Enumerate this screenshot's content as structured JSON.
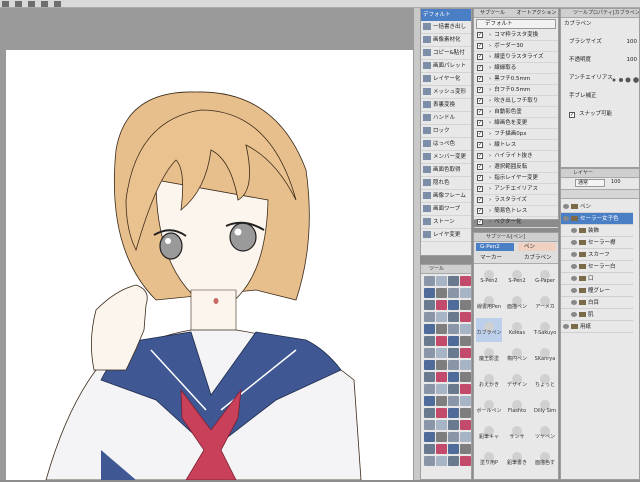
{
  "toolbar": {
    "buttons": [
      "icon-a",
      "icon-b",
      "icon-c",
      "icon-d",
      "icon-e"
    ]
  },
  "auto_action": {
    "tab1": "サブツール",
    "tab2": "オートアクション",
    "set": "デフォルト",
    "items": [
      "コマ枠ラスタ変換",
      "ボーダー30",
      "線塗りラスタライズ",
      "線縁取る",
      "黒フチ0.5mm",
      "白フチ0.5mm",
      "吹き出しフチ取り",
      "自動影色塗",
      "線画色を変更",
      "フチ描画0px",
      "線トレス",
      "ハイライト抜き",
      "選択範囲反転",
      "指示レイヤー変更",
      "アンチエイリアス",
      "ラスタライズ",
      "簡易色トレス",
      "ベクター化"
    ]
  },
  "left_list": {
    "header": "デフォルト",
    "items": [
      "一括書き出し",
      "画像素材化",
      "コピー&貼付",
      "画面パレット",
      "レイヤー化",
      "メッシュ変形",
      "表裏変換",
      "ハンドル",
      "ロック",
      "はっぺ色",
      "メンバー変更",
      "画面色取得",
      "隠れ色",
      "画像フレーム",
      "画面ワープ",
      "ストーン",
      "レイヤ変更"
    ]
  },
  "tool_property": {
    "title": "ツールプロパティ[カブラペン]",
    "tool": "カブラペン",
    "brush_size_label": "ブラシサイズ",
    "brush_size_val": "100",
    "opacity_label": "不透明度",
    "opacity_val": "100",
    "antialias_label": "アンチエイリアス",
    "correction_label": "手ブレ補正",
    "snap_label": "スナップ可能"
  },
  "subtool": {
    "title": "サブツール[ペン]",
    "tabs": [
      "G-Pen2",
      "ペン",
      "マーカー",
      "カブラペン"
    ],
    "grid": [
      [
        "S-Pen2",
        "S-Pen2",
        "G-Paper"
      ],
      [
        "線書用Pen",
        "面描ペン",
        "アーメカ"
      ],
      [
        "カブラペン",
        "Koleas",
        "T-Sakuyo"
      ],
      [
        "魔王影塗",
        "楕円ペン",
        "SKanrya"
      ],
      [
        "おえかき",
        "デザイン",
        "ちょっと"
      ],
      [
        "ボールペン",
        "Flashto",
        "Dilly Sim"
      ],
      [
        "鉛筆キャ",
        "サンサ",
        "ツヤペン"
      ],
      [
        "塗り用P",
        "鉛筆書き",
        "面描色す"
      ]
    ]
  },
  "layer": {
    "title": "レイヤー",
    "blend": "通常",
    "opacity": "100",
    "items": [
      "ペン",
      "セーラー女子色",
      "装飾",
      "セーラー襟",
      "スカーフ",
      "セーラー白",
      "口",
      "瞳グレー",
      "白目",
      "肌",
      "用紙"
    ]
  },
  "colors": {
    "accent": "#4a7fc6",
    "hair": "#eac28f",
    "skin": "#fbf3ec",
    "collar": "#3f5893",
    "scarf": "#c9405a"
  }
}
